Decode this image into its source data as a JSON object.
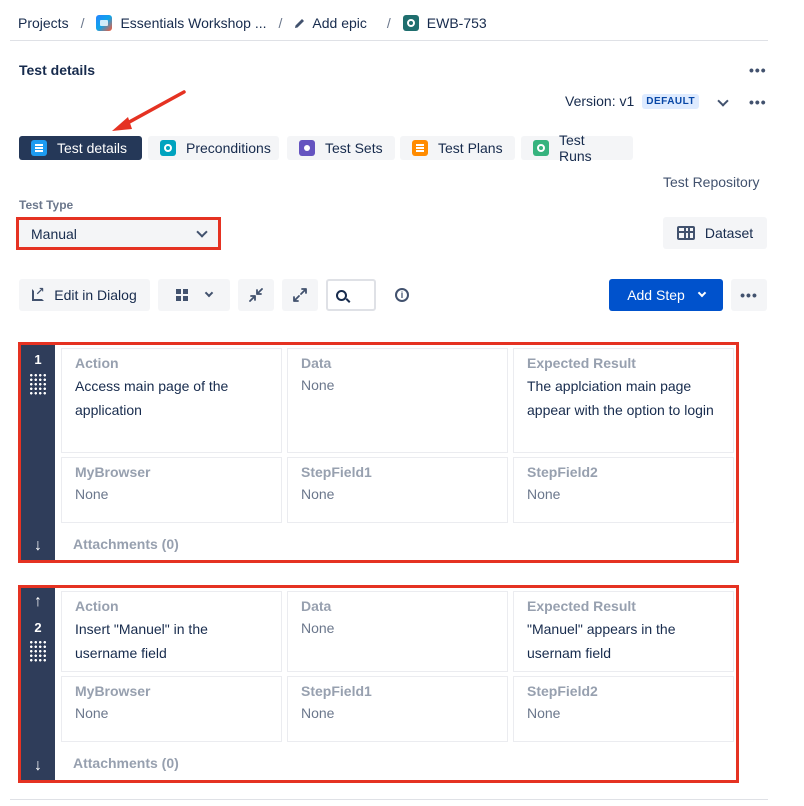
{
  "breadcrumb": {
    "projects": "Projects",
    "project": "Essentials Workshop ...",
    "add_epic": "Add epic",
    "issue_key": "EWB-753",
    "sep": "/"
  },
  "header": {
    "title": "Test details",
    "more": "•••",
    "version_label": "Version: v1",
    "default_badge": "DEFAULT"
  },
  "tabs": [
    {
      "label": "Test details",
      "icon": "list-icon",
      "active": true
    },
    {
      "label": "Preconditions",
      "icon": "precondition-icon"
    },
    {
      "label": "Test Sets",
      "icon": "test-sets-icon"
    },
    {
      "label": "Test Plans",
      "icon": "test-plans-icon"
    },
    {
      "label": "Test Runs",
      "icon": "test-runs-icon"
    }
  ],
  "test_repository": "Test Repository",
  "test_type": {
    "label": "Test Type",
    "value": "Manual"
  },
  "dataset": "Dataset",
  "toolbar": {
    "edit_dialog": "Edit in Dialog",
    "add_step": "Add Step",
    "more": "•••",
    "info": "i"
  },
  "steps": [
    {
      "number": "1",
      "action_label": "Action",
      "action_value": "Access main page of the application",
      "data_label": "Data",
      "data_value": "None",
      "expected_label": "Expected Result",
      "expected_value": "The applciation main page appear with the option to login",
      "browser_label": "MyBrowser",
      "browser_value": "None",
      "field1_label": "StepField1",
      "field1_value": "None",
      "field2_label": "StepField2",
      "field2_value": "None",
      "attachments": "Attachments (0)"
    },
    {
      "number": "2",
      "action_label": "Action",
      "action_value": "Insert \"Manuel\" in the username field",
      "data_label": "Data",
      "data_value": "None",
      "expected_label": "Expected Result",
      "expected_value": "\"Manuel\" appears in the usernam field",
      "browser_label": "MyBrowser",
      "browser_value": "None",
      "field1_label": "StepField1",
      "field1_value": "None",
      "field2_label": "StepField2",
      "field2_value": "None",
      "attachments": "Attachments (0)"
    }
  ],
  "colors": {
    "highlight_red": "#e53222",
    "active_tab": "#253858",
    "primary": "#0052cc",
    "step_bar": "#2f3d5a"
  }
}
